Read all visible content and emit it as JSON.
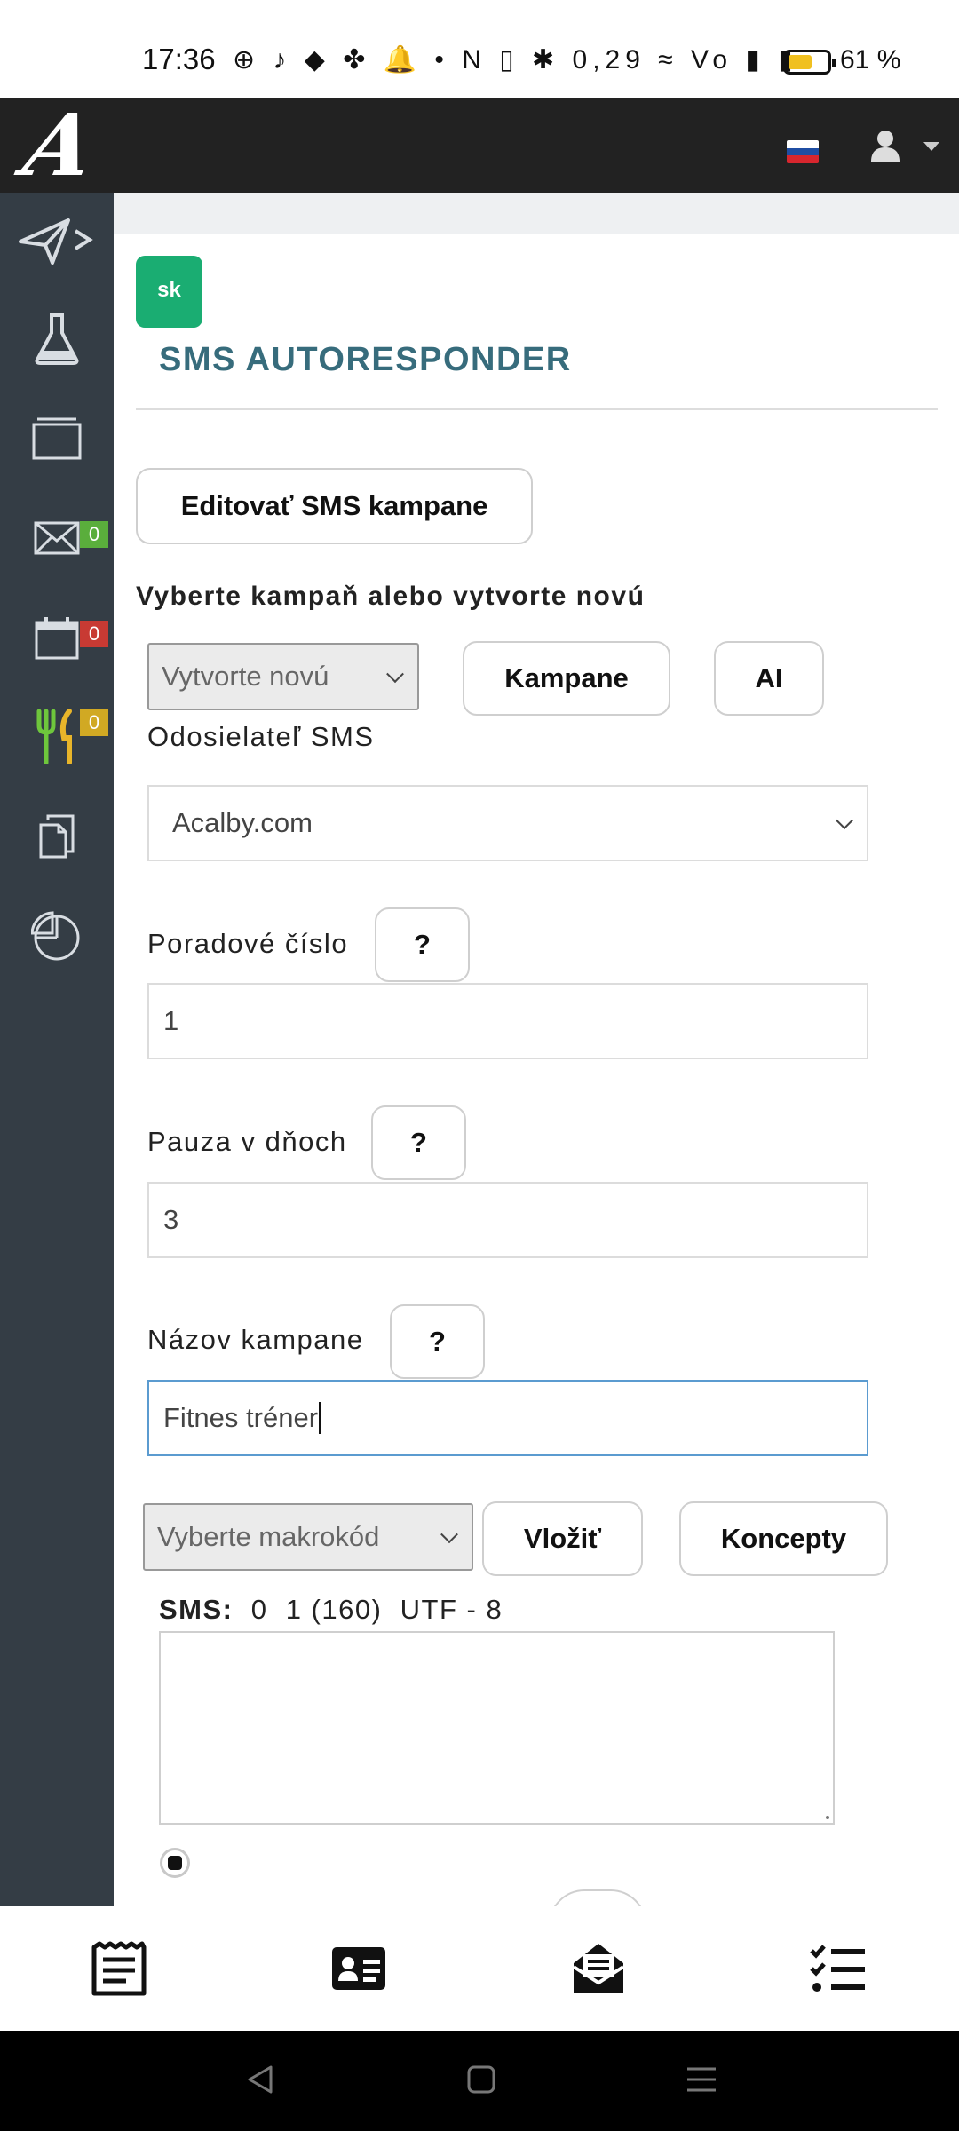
{
  "status_bar": {
    "time": "17:36",
    "icons_text": "⊕ ♪ ◆ ✤ 🔔 • N ▯ ✱ 0,29 ≈ Vo ▮ ▮",
    "battery_level": 0.61,
    "battery_pct": "61 %"
  },
  "topbar": {
    "logo": "A",
    "flag_colors": [
      "#ffffff",
      "#1f4ea3",
      "#d7262e"
    ],
    "user_icon": "user-icon"
  },
  "sidebar": {
    "items": [
      {
        "icon": "send-icon",
        "badge": null
      },
      {
        "icon": "flask-icon",
        "badge": null
      },
      {
        "icon": "window-icon",
        "badge": null
      },
      {
        "icon": "envelope-icon",
        "badge": "0",
        "badge_color": "#5aae3c"
      },
      {
        "icon": "calendar-icon",
        "badge": "0",
        "badge_color": "#c83a33"
      },
      {
        "icon": "fork-knife-icon",
        "badge": "0",
        "badge_color": "#d1a923"
      },
      {
        "icon": "documents-icon",
        "badge": null
      },
      {
        "icon": "pie-chart-icon",
        "badge": null
      }
    ]
  },
  "main": {
    "lang_badge": "sk",
    "title": "SMS AUTORESPONDER",
    "edit_button": "Editovať SMS kampane",
    "choose_label": "Vyberte kampaň alebo vytvorte novú",
    "campaign_select": "Vytvorte novú",
    "campaigns_button": "Kampane",
    "ai_button": "AI",
    "sender_label": "Odosielateľ SMS",
    "sender_value": "Acalby.com",
    "order_label": "Poradové číslo",
    "order_help": "?",
    "order_value": "1",
    "pause_label": "Pauza v dňoch",
    "pause_help": "?",
    "pause_value": "3",
    "name_label": "Názov kampane",
    "name_help": "?",
    "name_value": "Fitnes tréner",
    "macro_select": "Vyberte makrokód",
    "insert_button": "Vložiť",
    "drafts_button": "Koncepty",
    "sms_label": "SMS:",
    "sms_stats": "0  1 (160)  UTF - 8"
  },
  "bottom_nav": [
    "newspaper-icon",
    "contact-card-icon",
    "mail-open-icon",
    "checklist-icon"
  ],
  "system_nav": [
    "back-icon",
    "home-icon",
    "menu-icon"
  ],
  "colors": {
    "title": "#376c7c",
    "sidebar": "#343d45",
    "topbar": "#222222",
    "lang_badge": "#1aad72",
    "focus_border": "#5b9bd0"
  }
}
